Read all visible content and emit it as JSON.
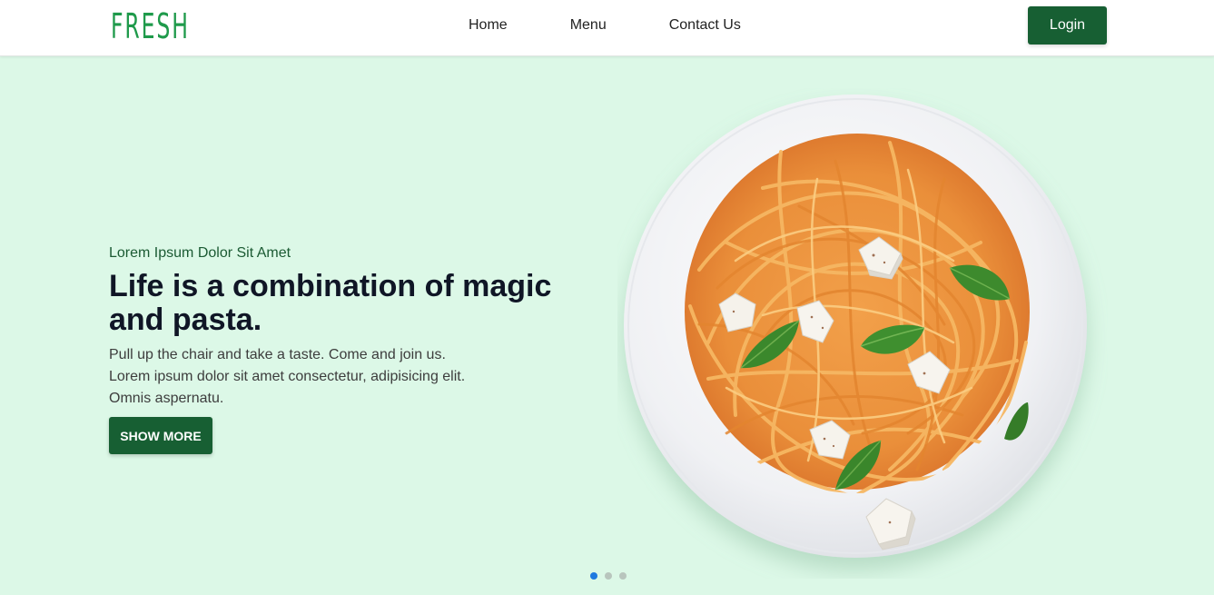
{
  "brand": {
    "logo_text": "FRESH",
    "primary_color": "#175f33",
    "logo_color": "#1f9a4b",
    "hero_background": "#dcf8e7"
  },
  "nav": {
    "items": [
      {
        "label": "Home"
      },
      {
        "label": "Menu"
      },
      {
        "label": "Contact Us"
      }
    ],
    "login_label": "Login"
  },
  "hero": {
    "kicker": "Lorem Ipsum Dolor Sit Amet",
    "title": "Life is a combination of magic and pasta.",
    "body_lines": [
      "Pull up the chair and take a taste. Come and join us.",
      "Lorem ipsum dolor sit amet consectetur, adipisicing elit.",
      "Omnis aspernatu."
    ],
    "cta_label": "SHOW MORE",
    "image_subject": "spaghetti-plate-image"
  },
  "carousel": {
    "slide_count": 3,
    "active_index": 0,
    "active_color": "#1f7ae0",
    "inactive_color": "#b8c5bd"
  }
}
